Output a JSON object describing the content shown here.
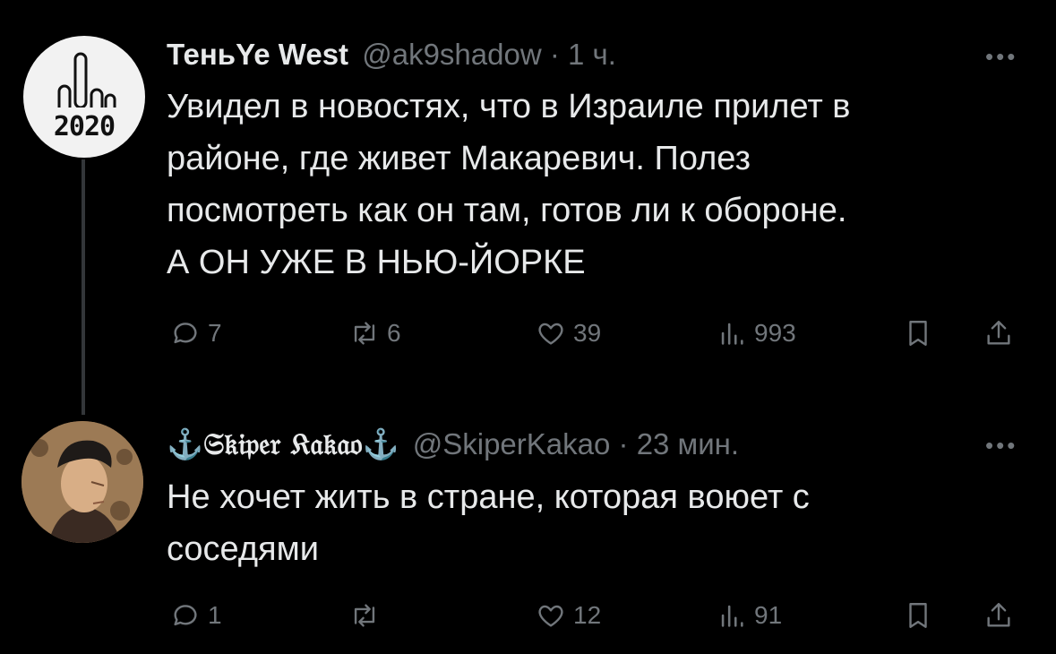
{
  "tweets": [
    {
      "name": "ТеньYe West",
      "handle": "@ak9shadow",
      "separator": "·",
      "time": "1 ч.",
      "more": "•••",
      "avatar_label": "2020",
      "text_lines": [
        "Увидел в новостях, что в Израиле прилет в",
        "районе, где живет Макаревич. Полез",
        "посмотреть как он там, готов ли к обороне.",
        "А ОН УЖЕ В НЬЮ-ЙОРКЕ"
      ],
      "stats": {
        "replies": "7",
        "retweets": "6",
        "likes": "39",
        "views": "993"
      }
    },
    {
      "name": "⚓𝔖𝔨𝔦𝔭𝔢𝔯 𝔎𝔞𝔨𝔞𝔬⚓",
      "handle": "@SkiperKakao",
      "separator": "·",
      "time": "23 мин.",
      "more": "•••",
      "text_lines": [
        "Не хочет жить в стране, которая воюет с",
        "соседями"
      ],
      "stats": {
        "replies": "1",
        "retweets": "",
        "likes": "12",
        "views": "91"
      }
    }
  ],
  "colors": {
    "background": "#000000",
    "text": "#e7e9ea",
    "muted": "#71767b"
  }
}
